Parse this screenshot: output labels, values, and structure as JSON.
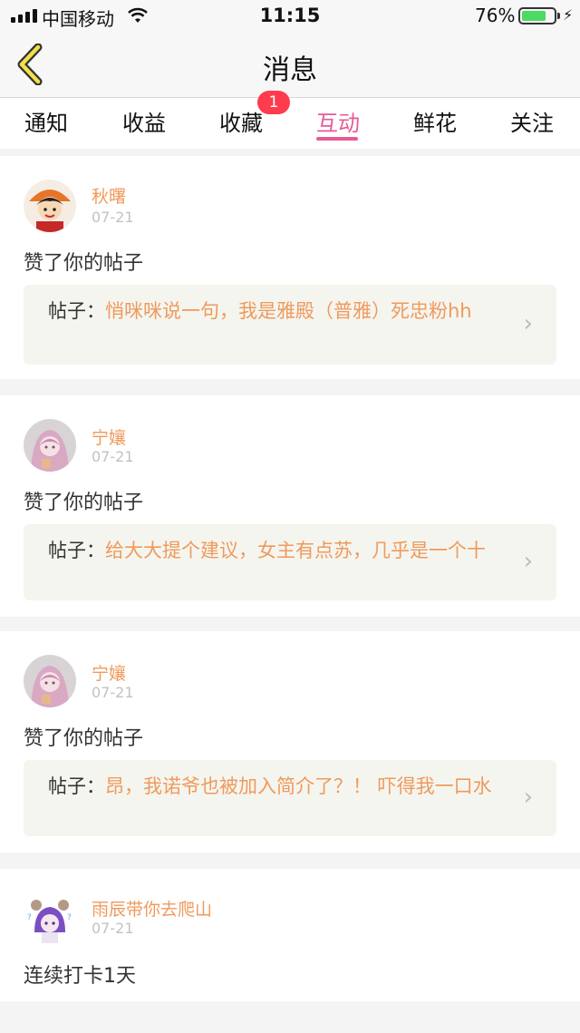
{
  "status_bar": {
    "carrier": "中国移动",
    "time": "11:15",
    "battery_percent_label": "76%",
    "battery_level": 0.76
  },
  "nav": {
    "title": "消息"
  },
  "tabs": [
    {
      "label": "通知"
    },
    {
      "label": "收益"
    },
    {
      "label": "收藏",
      "badge": "1"
    },
    {
      "label": "互动",
      "active": true
    },
    {
      "label": "鲜花"
    },
    {
      "label": "关注"
    }
  ],
  "colors": {
    "accent": "#e55b95",
    "username": "#ef9a5c",
    "badge": "#ff3b4e"
  },
  "messages": [
    {
      "username": "秋曙",
      "date": "07-21",
      "action": "赞了你的帖子",
      "post_prefix": "帖子：",
      "post_text": "悄咪咪说一句，我是雅殿（普雅）死忠粉hh"
    },
    {
      "username": "宁孃",
      "date": "07-21",
      "action": "赞了你的帖子",
      "post_prefix": "帖子：",
      "post_text": "给大大提个建议，女主有点苏，几乎是一个十"
    },
    {
      "username": "宁孃",
      "date": "07-21",
      "action": "赞了你的帖子",
      "post_prefix": "帖子：",
      "post_text": "昂，我诺爷也被加入简介了？！ 吓得我一口水"
    },
    {
      "username": "雨辰带你去爬山",
      "date": "07-21",
      "action": "连续打卡1天"
    }
  ]
}
